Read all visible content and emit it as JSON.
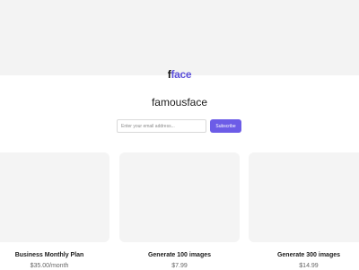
{
  "header": {
    "logo": {
      "first_letter": "f",
      "rest": "face"
    },
    "title": "famousface"
  },
  "subscribe": {
    "email_placeholder": "Enter your email address...",
    "button_label": "Subscribe"
  },
  "products": [
    {
      "title": "Business Monthly Plan",
      "price": "$35.00/month"
    },
    {
      "title": "Generate 100 images",
      "price": "$7.99"
    },
    {
      "title": "Generate 300 images",
      "price": "$14.99"
    }
  ],
  "colors": {
    "accent": "#6c5ce7",
    "logo_accent": "#5b4fd9",
    "cover_background": "#f3f3f3",
    "card_background": "#f4f4f4"
  }
}
